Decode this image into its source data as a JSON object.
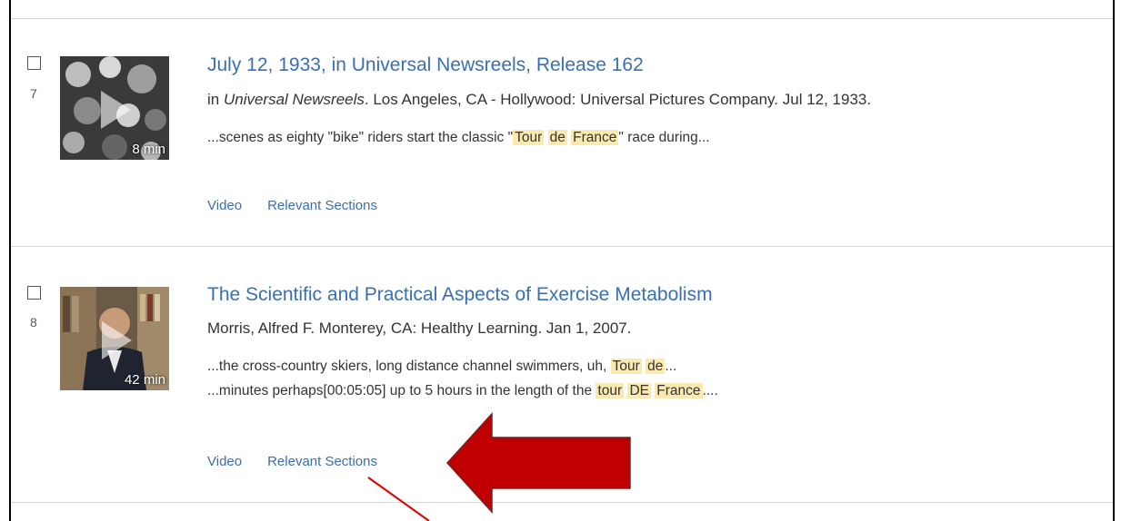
{
  "results": [
    {
      "index": "7",
      "duration": "8 min",
      "title": "July 12, 1933, in Universal Newsreels, Release 162",
      "meta_prefix": "in ",
      "meta_italic": "Universal Newsreels",
      "meta_suffix": ". Los Angeles, CA - Hollywood: Universal Pictures Company. Jul 12, 1933.",
      "snippet": {
        "a": "...scenes as eighty \"bike\" riders start the classic \"",
        "h1": "Tour",
        "h2": "de",
        "h3": "France",
        "b": "\" race during..."
      },
      "links": [
        "Video",
        "Relevant Sections"
      ]
    },
    {
      "index": "8",
      "duration": "42 min",
      "title": "The Scientific and Practical Aspects of Exercise Metabolism",
      "meta": "Morris, Alfred F. Monterey, CA: Healthy Learning. Jan 1, 2007.",
      "snippet1": {
        "a": "...the cross-country skiers, long distance channel swimmers, uh, ",
        "h1": "Tour",
        "h2": "de",
        "b": "..."
      },
      "snippet2": {
        "a": "...minutes perhaps[00:05:05] up to 5 hours in the length of the ",
        "h1": "tour",
        "h2": "DE",
        "h3": "France",
        "b": "...."
      },
      "links": [
        "Video",
        "Relevant Sections"
      ]
    }
  ],
  "annotation": {
    "arrow_color": "#c00000",
    "line_color": "#e00000"
  }
}
